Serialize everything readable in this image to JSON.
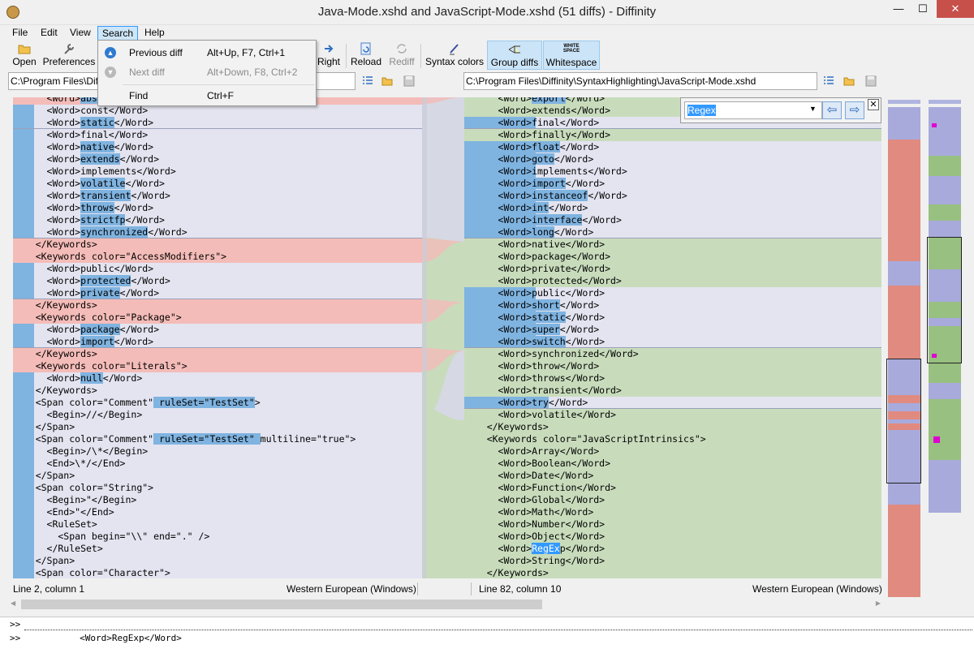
{
  "window": {
    "title": "Java-Mode.xshd and JavaScript-Mode.xshd (51 diffs) - Diffinity",
    "minimize": "—",
    "maximize": "☐",
    "close": "✕"
  },
  "menu": {
    "file": "File",
    "edit": "Edit",
    "view": "View",
    "search": "Search",
    "help": "Help"
  },
  "toolbar": {
    "open": "Open",
    "preferences": "Preferences",
    "right": "Right",
    "reload": "Reload",
    "rediff": "Rediff",
    "syntax_colors": "Syntax colors",
    "group_diffs": "Group diffs",
    "whitespace": "Whitespace",
    "whitespace_icon_text": "WHITE SPACE"
  },
  "search_menu": {
    "previous_diff": "Previous diff",
    "previous_diff_shortcut": "Alt+Up, F7, Ctrl+1",
    "next_diff": "Next diff",
    "next_diff_shortcut": "Alt+Down, F8, Ctrl+2",
    "find": "Find",
    "find_shortcut": "Ctrl+F"
  },
  "left_path": "C:\\Program Files\\Diffinity\\SyntaxHighlighting\\Java-Mode.xshd",
  "right_path": "C:\\Program Files\\Diffinity\\SyntaxHighlighting\\JavaScript-Mode.xshd",
  "find": {
    "value": "Regex"
  },
  "left_lines": [
    {
      "a": "      <Word>",
      "b": "abs",
      "c": "</Word>"
    },
    {
      "a": "      <Word>const</Word>",
      "b": "",
      "c": ""
    },
    {
      "a": "      <Word>",
      "b": "static",
      "c": "</Word>"
    },
    {
      "a": "      <Word>final</Word>",
      "b": "",
      "c": ""
    },
    {
      "a": "      <Word>",
      "b": "native",
      "c": "</Word>"
    },
    {
      "a": "      <Word>",
      "b": "extends",
      "c": "</Word>"
    },
    {
      "a": "      <Word>implements</Word>",
      "b": "",
      "c": ""
    },
    {
      "a": "      <Word>",
      "b": "volatile",
      "c": "</Word>"
    },
    {
      "a": "      <Word>",
      "b": "transient",
      "c": "</Word>"
    },
    {
      "a": "      <Word>",
      "b": "throws",
      "c": "</Word>"
    },
    {
      "a": "      <Word>",
      "b": "strictfp",
      "c": "</Word>"
    },
    {
      "a": "      <Word>",
      "b": "synchronized",
      "c": "</Word>"
    },
    {
      "a": "    </Keywords>",
      "b": "",
      "c": ""
    },
    {
      "a": "    <Keywords color=\"AccessModifiers\">",
      "b": "",
      "c": ""
    },
    {
      "a": "      <Word>public</Word>",
      "b": "",
      "c": ""
    },
    {
      "a": "      <Word>",
      "b": "protected",
      "c": "</Word>"
    },
    {
      "a": "      <Word>",
      "b": "private",
      "c": "</Word>"
    },
    {
      "a": "    </Keywords>",
      "b": "",
      "c": ""
    },
    {
      "a": "    <Keywords color=\"Package\">",
      "b": "",
      "c": ""
    },
    {
      "a": "      <Word>",
      "b": "package",
      "c": "</Word>"
    },
    {
      "a": "      <Word>",
      "b": "import",
      "c": "</Word>"
    },
    {
      "a": "    </Keywords>",
      "b": "",
      "c": ""
    },
    {
      "a": "    <Keywords color=\"Literals\">",
      "b": "",
      "c": ""
    },
    {
      "a": "      <Word>",
      "b": "null",
      "c": "</Word>"
    },
    {
      "a": "    </Keywords>",
      "b": "",
      "c": ""
    },
    {
      "a": "    <Span color=\"Comment\"",
      "b": " ruleSet=\"TestSet\"",
      "c": ">"
    },
    {
      "a": "      <Begin>//</Begin>",
      "b": "",
      "c": ""
    },
    {
      "a": "    </Span>",
      "b": "",
      "c": ""
    },
    {
      "a": "    <Span color=\"Comment\"",
      "b": " ruleSet=\"TestSet\" ",
      "c": "multiline=\"true\">"
    },
    {
      "a": "      <Begin>/\\*</Begin>",
      "b": "",
      "c": ""
    },
    {
      "a": "      <End>\\*/</End>",
      "b": "",
      "c": ""
    },
    {
      "a": "    </Span>",
      "b": "",
      "c": ""
    },
    {
      "a": "    <Span color=\"String\">",
      "b": "",
      "c": ""
    },
    {
      "a": "      <Begin>\"</Begin>",
      "b": "",
      "c": ""
    },
    {
      "a": "      <End>\"</End>",
      "b": "",
      "c": ""
    },
    {
      "a": "      <RuleSet>",
      "b": "",
      "c": ""
    },
    {
      "a": "        <Span begin=\"\\\\\" end=\".\" />",
      "b": "",
      "c": ""
    },
    {
      "a": "      </RuleSet>",
      "b": "",
      "c": ""
    },
    {
      "a": "    </Span>",
      "b": "",
      "c": ""
    },
    {
      "a": "    <Span color=\"Character\">",
      "b": "",
      "c": ""
    }
  ],
  "right_lines": [
    {
      "a": "      <Word>",
      "b": "export",
      "c": "</Word>"
    },
    {
      "a": "      <Word>extends</Word>",
      "b": "",
      "c": ""
    },
    {
      "a": "      <Word>final</Word>",
      "b": "",
      "c": ""
    },
    {
      "a": "      <Word>finally</Word>",
      "b": "",
      "c": ""
    },
    {
      "a": "      <Word>",
      "b": "float",
      "c": "</Word>"
    },
    {
      "a": "      <Word>",
      "b": "goto",
      "c": "</Word>"
    },
    {
      "a": "      <Word>implements</Word>",
      "b": "",
      "c": ""
    },
    {
      "a": "      <Word>",
      "b": "import",
      "c": "</Word>"
    },
    {
      "a": "      <Word>",
      "b": "instanceof",
      "c": "</Word>"
    },
    {
      "a": "      <Word>",
      "b": "int",
      "c": "</Word>"
    },
    {
      "a": "      <Word>",
      "b": "interface",
      "c": "</Word>"
    },
    {
      "a": "      <Word>",
      "b": "long",
      "c": "</Word>"
    },
    {
      "a": "      <Word>native</Word>",
      "b": "",
      "c": ""
    },
    {
      "a": "      <Word>package</Word>",
      "b": "",
      "c": ""
    },
    {
      "a": "      <Word>private</Word>",
      "b": "",
      "c": ""
    },
    {
      "a": "      <Word>protected</Word>",
      "b": "",
      "c": ""
    },
    {
      "a": "      <Word>public</Word>",
      "b": "",
      "c": ""
    },
    {
      "a": "      <Word>",
      "b": "short",
      "c": "</Word>"
    },
    {
      "a": "      <Word>",
      "b": "static",
      "c": "</Word>"
    },
    {
      "a": "      <Word>",
      "b": "super",
      "c": "</Word>"
    },
    {
      "a": "      <Word>",
      "b": "switch",
      "c": "</Word>"
    },
    {
      "a": "      <Word>synchronized</Word>",
      "b": "",
      "c": ""
    },
    {
      "a": "      <Word>throw</Word>",
      "b": "",
      "c": ""
    },
    {
      "a": "      <Word>throws</Word>",
      "b": "",
      "c": ""
    },
    {
      "a": "      <Word>transient</Word>",
      "b": "",
      "c": ""
    },
    {
      "a": "      <Word>",
      "b": "try",
      "c": "</Word>"
    },
    {
      "a": "      <Word>volatile</Word>",
      "b": "",
      "c": ""
    },
    {
      "a": "    </Keywords>",
      "b": "",
      "c": ""
    },
    {
      "a": "    <Keywords color=\"JavaScriptIntrinsics\">",
      "b": "",
      "c": ""
    },
    {
      "a": "      <Word>Array</Word>",
      "b": "",
      "c": ""
    },
    {
      "a": "      <Word>Boolean</Word>",
      "b": "",
      "c": ""
    },
    {
      "a": "      <Word>Date</Word>",
      "b": "",
      "c": ""
    },
    {
      "a": "      <Word>Function</Word>",
      "b": "",
      "c": ""
    },
    {
      "a": "      <Word>Global</Word>",
      "b": "",
      "c": ""
    },
    {
      "a": "      <Word>Math</Word>",
      "b": "",
      "c": ""
    },
    {
      "a": "      <Word>Number</Word>",
      "b": "",
      "c": ""
    },
    {
      "a": "      <Word>Object</Word>",
      "b": "",
      "c": ""
    },
    {
      "a": "      <Word>",
      "b": "RegEx",
      "c": "p</Word>"
    },
    {
      "a": "      <Word>String</Word>",
      "b": "",
      "c": ""
    },
    {
      "a": "    </Keywords>",
      "b": "",
      "c": ""
    }
  ],
  "status": {
    "left_position": "Line 2, column 1",
    "left_encoding": "Western European (Windows)",
    "right_position": "Line 82, column 10",
    "right_encoding": "Western European (Windows)"
  },
  "command": {
    "line1": ">>",
    "line2": ">>           <Word>RegExp</Word>"
  },
  "colors": {
    "accent": "#3399ff",
    "deleted": "#f4bcb8",
    "added": "#c8dcbc",
    "changed": "#e3e4f0",
    "word_highlight": "#7fb3e0"
  }
}
